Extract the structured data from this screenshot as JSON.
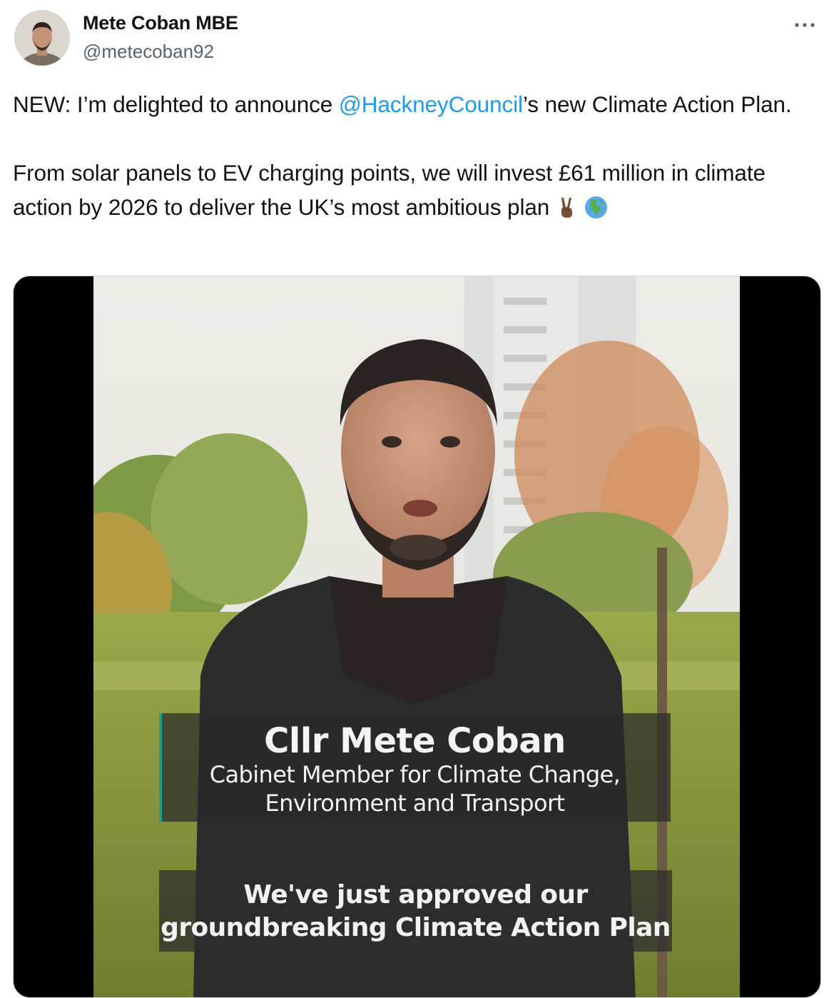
{
  "author": {
    "display_name": "Mete Coban MBE",
    "handle": "@metecoban92",
    "avatar_icon": "profile-photo"
  },
  "more_icon": "more-options-icon",
  "tweet": {
    "line1_before": "NEW: I’m delighted to announce ",
    "mention": "@HackneyCouncil",
    "line1_after": "’s new Climate Action Plan.",
    "paragraph2": "From solar panels to EV charging points, we will invest £61 million in climate action by 2026 to deliver the UK’s most ambitious plan",
    "emojis": [
      "victory-hand-medium-dark-skin-tone",
      "globe-europe-africa"
    ]
  },
  "video": {
    "caption_name": "Cllr Mete Coban",
    "caption_role_line1": "Cabinet Member for Climate Change,",
    "caption_role_line2": "Environment and Transport",
    "subtitle_line1": "We've just approved our",
    "subtitle_line2": "groundbreaking Climate Action Plan"
  },
  "colors": {
    "text": "#0f1419",
    "secondary": "#536471",
    "link": "#1d9bf0",
    "caption_accent": "#1aa08a"
  }
}
